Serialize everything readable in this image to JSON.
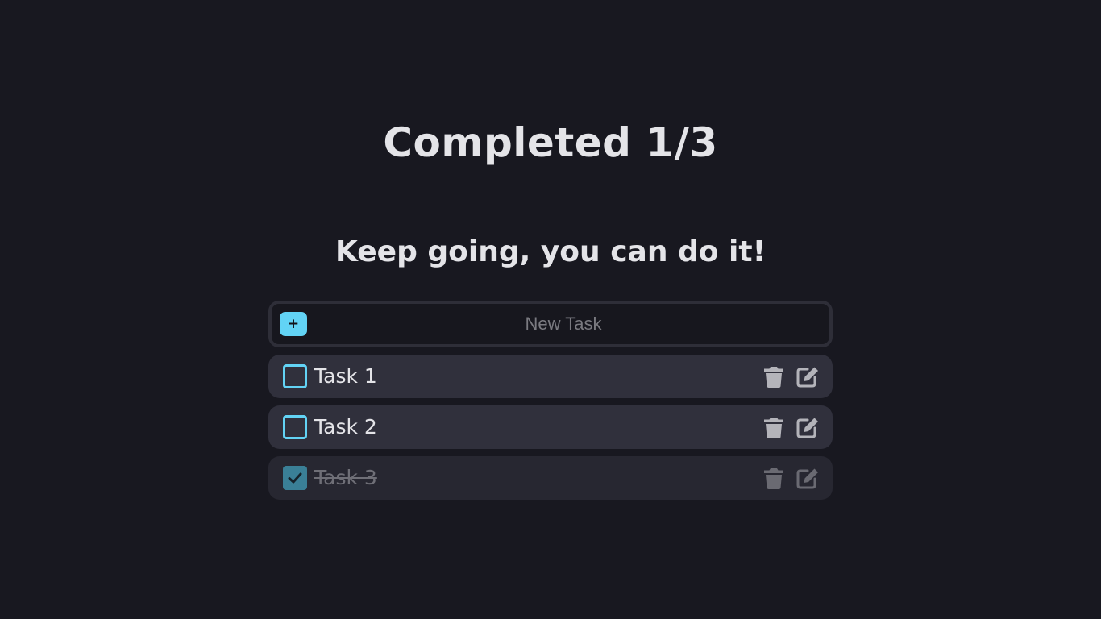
{
  "header": {
    "completed_text": "Completed 1/3",
    "completed_count": 1,
    "total_count": 3,
    "encouragement": "Keep going, you can do it!"
  },
  "new_task": {
    "add_label": "+",
    "placeholder": "New Task",
    "value": ""
  },
  "tasks": [
    {
      "label": "Task 1",
      "completed": false
    },
    {
      "label": "Task 2",
      "completed": false
    },
    {
      "label": "Task 3",
      "completed": true
    }
  ],
  "icons": {
    "add": "plus-icon",
    "delete": "trash-icon",
    "edit": "edit-icon",
    "check": "check-icon"
  },
  "colors": {
    "background": "#181820",
    "accent": "#62d3f5",
    "checked_box": "#3a7f96",
    "row": "#30303c",
    "row_done": "#272731",
    "text": "#e4e4e8",
    "muted_text": "#6f6f77",
    "icon": "#b4b4ba"
  }
}
